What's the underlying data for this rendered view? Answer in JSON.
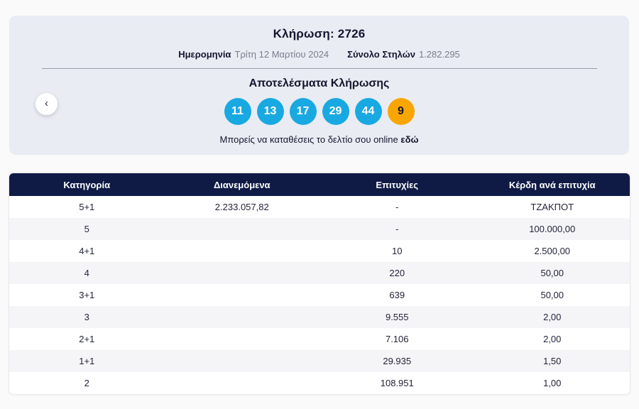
{
  "panel": {
    "draw_label": "Κλήρωση: 2726",
    "date_label": "Ημερομηνία",
    "date_value": "Τρίτη 12 Μαρτίου 2024",
    "columns_label": "Σύνολο Στηλών",
    "columns_value": "1.282.295",
    "results_title": "Αποτελέσματα Κλήρωσης",
    "numbers": [
      "11",
      "13",
      "17",
      "29",
      "44"
    ],
    "bonus_number": "9",
    "online_text": "Μπορείς να καταθέσεις το δελτίο σου online",
    "online_link_label": "εδώ",
    "prev_icon": "‹"
  },
  "colors": {
    "ball_blue": "#18a9e2",
    "ball_bonus": "#f9a602",
    "header_navy": "#0f1b45",
    "panel_bg": "#e9ecf3"
  },
  "table": {
    "headers": [
      "Κατηγορία",
      "Διανεμόμενα",
      "Επιτυχίες",
      "Κέρδη ανά επιτυχία"
    ],
    "rows": [
      [
        "5+1",
        "2.233.057,82",
        "-",
        "ΤΖΑΚΠΟΤ"
      ],
      [
        "5",
        "",
        "-",
        "100.000,00"
      ],
      [
        "4+1",
        "",
        "10",
        "2.500,00"
      ],
      [
        "4",
        "",
        "220",
        "50,00"
      ],
      [
        "3+1",
        "",
        "639",
        "50,00"
      ],
      [
        "3",
        "",
        "9.555",
        "2,00"
      ],
      [
        "2+1",
        "",
        "7.106",
        "2,00"
      ],
      [
        "1+1",
        "",
        "29.935",
        "1,50"
      ],
      [
        "2",
        "",
        "108.951",
        "1,00"
      ]
    ]
  }
}
